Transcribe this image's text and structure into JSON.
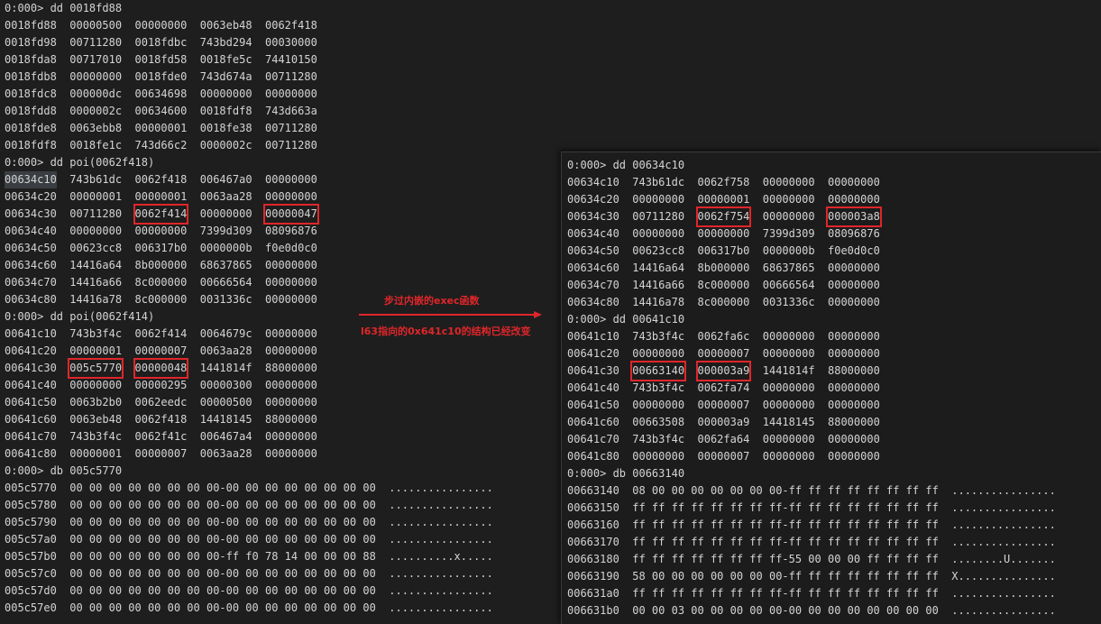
{
  "left": {
    "lines": [
      {
        "type": "cmd",
        "text": "0:000> dd 0018fd88"
      },
      {
        "type": "row",
        "addr": "0018fd88",
        "cols": [
          "00000500",
          "00000000",
          "0063eb48",
          "0062f418"
        ]
      },
      {
        "type": "row",
        "addr": "0018fd98",
        "cols": [
          "00711280",
          "0018fdbc",
          "743bd294",
          "00030000"
        ]
      },
      {
        "type": "row",
        "addr": "0018fda8",
        "cols": [
          "00717010",
          "0018fd58",
          "0018fe5c",
          "74410150"
        ]
      },
      {
        "type": "row",
        "addr": "0018fdb8",
        "cols": [
          "00000000",
          "0018fde0",
          "743d674a",
          "00711280"
        ]
      },
      {
        "type": "row",
        "addr": "0018fdc8",
        "cols": [
          "000000dc",
          "00634698",
          "00000000",
          "00000000"
        ]
      },
      {
        "type": "row",
        "addr": "0018fdd8",
        "cols": [
          "0000002c",
          "00634600",
          "0018fdf8",
          "743d663a"
        ]
      },
      {
        "type": "row",
        "addr": "0018fde8",
        "cols": [
          "0063ebb8",
          "00000001",
          "0018fe38",
          "00711280"
        ]
      },
      {
        "type": "row",
        "addr": "0018fdf8",
        "cols": [
          "0018fe1c",
          "743d66c2",
          "0000002c",
          "00711280"
        ]
      },
      {
        "type": "cmd",
        "text": "0:000> dd poi(0062f418)"
      },
      {
        "type": "row",
        "addr": "00634c10",
        "sel": true,
        "cols": [
          "743b61dc",
          "0062f418",
          "006467a0",
          "00000000"
        ]
      },
      {
        "type": "row",
        "addr": "00634c20",
        "cols": [
          "00000001",
          "00000001",
          "0063aa28",
          "00000000"
        ]
      },
      {
        "type": "row",
        "addr": "00634c30",
        "cols": [
          "00711280",
          "0062f414",
          "00000000",
          "00000047"
        ],
        "hl": [
          1,
          3
        ]
      },
      {
        "type": "row",
        "addr": "00634c40",
        "cols": [
          "00000000",
          "00000000",
          "7399d309",
          "08096876"
        ]
      },
      {
        "type": "row",
        "addr": "00634c50",
        "cols": [
          "00623cc8",
          "006317b0",
          "0000000b",
          "f0e0d0c0"
        ]
      },
      {
        "type": "row",
        "addr": "00634c60",
        "cols": [
          "14416a64",
          "8b000000",
          "68637865",
          "00000000"
        ]
      },
      {
        "type": "row",
        "addr": "00634c70",
        "cols": [
          "14416a66",
          "8c000000",
          "00666564",
          "00000000"
        ]
      },
      {
        "type": "row",
        "addr": "00634c80",
        "cols": [
          "14416a78",
          "8c000000",
          "0031336c",
          "00000000"
        ]
      },
      {
        "type": "cmd",
        "text": "0:000> dd poi(0062f414)"
      },
      {
        "type": "row",
        "addr": "00641c10",
        "cols": [
          "743b3f4c",
          "0062f414",
          "0064679c",
          "00000000"
        ]
      },
      {
        "type": "row",
        "addr": "00641c20",
        "cols": [
          "00000001",
          "00000007",
          "0063aa28",
          "00000000"
        ]
      },
      {
        "type": "row",
        "addr": "00641c30",
        "cols": [
          "005c5770",
          "00000048",
          "1441814f",
          "88000000"
        ],
        "hl": [
          0,
          1
        ]
      },
      {
        "type": "row",
        "addr": "00641c40",
        "cols": [
          "00000000",
          "00000295",
          "00000300",
          "00000000"
        ]
      },
      {
        "type": "row",
        "addr": "00641c50",
        "cols": [
          "0063b2b0",
          "0062eedc",
          "00000500",
          "00000000"
        ]
      },
      {
        "type": "row",
        "addr": "00641c60",
        "cols": [
          "0063eb48",
          "0062f418",
          "14418145",
          "88000000"
        ]
      },
      {
        "type": "row",
        "addr": "00641c70",
        "cols": [
          "743b3f4c",
          "0062f41c",
          "006467a4",
          "00000000"
        ]
      },
      {
        "type": "row",
        "addr": "00641c80",
        "cols": [
          "00000001",
          "00000007",
          "0063aa28",
          "00000000"
        ]
      },
      {
        "type": "cmd",
        "text": "0:000> db 005c5770"
      },
      {
        "type": "raw",
        "text": "005c5770  00 00 00 00 00 00 00 00-00 00 00 00 00 00 00 00  ................"
      },
      {
        "type": "raw",
        "text": "005c5780  00 00 00 00 00 00 00 00-00 00 00 00 00 00 00 00  ................"
      },
      {
        "type": "raw",
        "text": "005c5790  00 00 00 00 00 00 00 00-00 00 00 00 00 00 00 00  ................"
      },
      {
        "type": "raw",
        "text": "005c57a0  00 00 00 00 00 00 00 00-00 00 00 00 00 00 00 00  ................"
      },
      {
        "type": "raw",
        "text": "005c57b0  00 00 00 00 00 00 00 00-ff f0 78 14 00 00 00 88  ..........x....."
      },
      {
        "type": "raw",
        "text": "005c57c0  00 00 00 00 00 00 00 00-00 00 00 00 00 00 00 00  ................"
      },
      {
        "type": "raw",
        "text": "005c57d0  00 00 00 00 00 00 00 00-00 00 00 00 00 00 00 00  ................"
      },
      {
        "type": "raw",
        "text": "005c57e0  00 00 00 00 00 00 00 00-00 00 00 00 00 00 00 00  ................"
      }
    ]
  },
  "right": {
    "lines": [
      {
        "type": "cmd",
        "text": "0:000> dd 00634c10"
      },
      {
        "type": "row",
        "addr": "00634c10",
        "cols": [
          "743b61dc",
          "0062f758",
          "00000000",
          "00000000"
        ]
      },
      {
        "type": "row",
        "addr": "00634c20",
        "cols": [
          "00000000",
          "00000001",
          "00000000",
          "00000000"
        ]
      },
      {
        "type": "row",
        "addr": "00634c30",
        "cols": [
          "00711280",
          "0062f754",
          "00000000",
          "000003a8"
        ],
        "hl": [
          1,
          3
        ]
      },
      {
        "type": "row",
        "addr": "00634c40",
        "cols": [
          "00000000",
          "00000000",
          "7399d309",
          "08096876"
        ]
      },
      {
        "type": "row",
        "addr": "00634c50",
        "cols": [
          "00623cc8",
          "006317b0",
          "0000000b",
          "f0e0d0c0"
        ]
      },
      {
        "type": "row",
        "addr": "00634c60",
        "cols": [
          "14416a64",
          "8b000000",
          "68637865",
          "00000000"
        ]
      },
      {
        "type": "row",
        "addr": "00634c70",
        "cols": [
          "14416a66",
          "8c000000",
          "00666564",
          "00000000"
        ]
      },
      {
        "type": "row",
        "addr": "00634c80",
        "cols": [
          "14416a78",
          "8c000000",
          "0031336c",
          "00000000"
        ]
      },
      {
        "type": "cmd",
        "text": "0:000> dd 00641c10"
      },
      {
        "type": "row",
        "addr": "00641c10",
        "cols": [
          "743b3f4c",
          "0062fa6c",
          "00000000",
          "00000000"
        ]
      },
      {
        "type": "row",
        "addr": "00641c20",
        "cols": [
          "00000000",
          "00000007",
          "00000000",
          "00000000"
        ]
      },
      {
        "type": "row",
        "addr": "00641c30",
        "cols": [
          "00663140",
          "000003a9",
          "1441814f",
          "88000000"
        ],
        "hl": [
          0,
          1
        ]
      },
      {
        "type": "row",
        "addr": "00641c40",
        "cols": [
          "743b3f4c",
          "0062fa74",
          "00000000",
          "00000000"
        ]
      },
      {
        "type": "row",
        "addr": "00641c50",
        "cols": [
          "00000000",
          "00000007",
          "00000000",
          "00000000"
        ]
      },
      {
        "type": "row",
        "addr": "00641c60",
        "cols": [
          "00663508",
          "000003a9",
          "14418145",
          "88000000"
        ]
      },
      {
        "type": "row",
        "addr": "00641c70",
        "cols": [
          "743b3f4c",
          "0062fa64",
          "00000000",
          "00000000"
        ]
      },
      {
        "type": "row",
        "addr": "00641c80",
        "cols": [
          "00000000",
          "00000007",
          "00000000",
          "00000000"
        ]
      },
      {
        "type": "cmd",
        "text": "0:000> db 00663140"
      },
      {
        "type": "raw",
        "text": "00663140  08 00 00 00 00 00 00 00-ff ff ff ff ff ff ff ff  ................"
      },
      {
        "type": "raw",
        "text": "00663150  ff ff ff ff ff ff ff ff-ff ff ff ff ff ff ff ff  ................"
      },
      {
        "type": "raw",
        "text": "00663160  ff ff ff ff ff ff ff ff-ff ff ff ff ff ff ff ff  ................"
      },
      {
        "type": "raw",
        "text": "00663170  ff ff ff ff ff ff ff ff-ff ff ff ff ff ff ff ff  ................"
      },
      {
        "type": "raw",
        "text": "00663180  ff ff ff ff ff ff ff ff-55 00 00 00 ff ff ff ff  ........U......."
      },
      {
        "type": "raw",
        "text": "00663190  58 00 00 00 00 00 00 00-ff ff ff ff ff ff ff ff  X..............."
      },
      {
        "type": "raw",
        "text": "006631a0  ff ff ff ff ff ff ff ff-ff ff ff ff ff ff ff ff  ................"
      },
      {
        "type": "raw",
        "text": "006631b0  00 00 03 00 00 00 00 00-00 00 00 00 00 00 00 00  ................"
      }
    ]
  },
  "annotation": {
    "line1": "步过内嵌的exec函数",
    "line2": "l63指向的0x641c10的结构已经改变",
    "color": "#e0262a"
  }
}
